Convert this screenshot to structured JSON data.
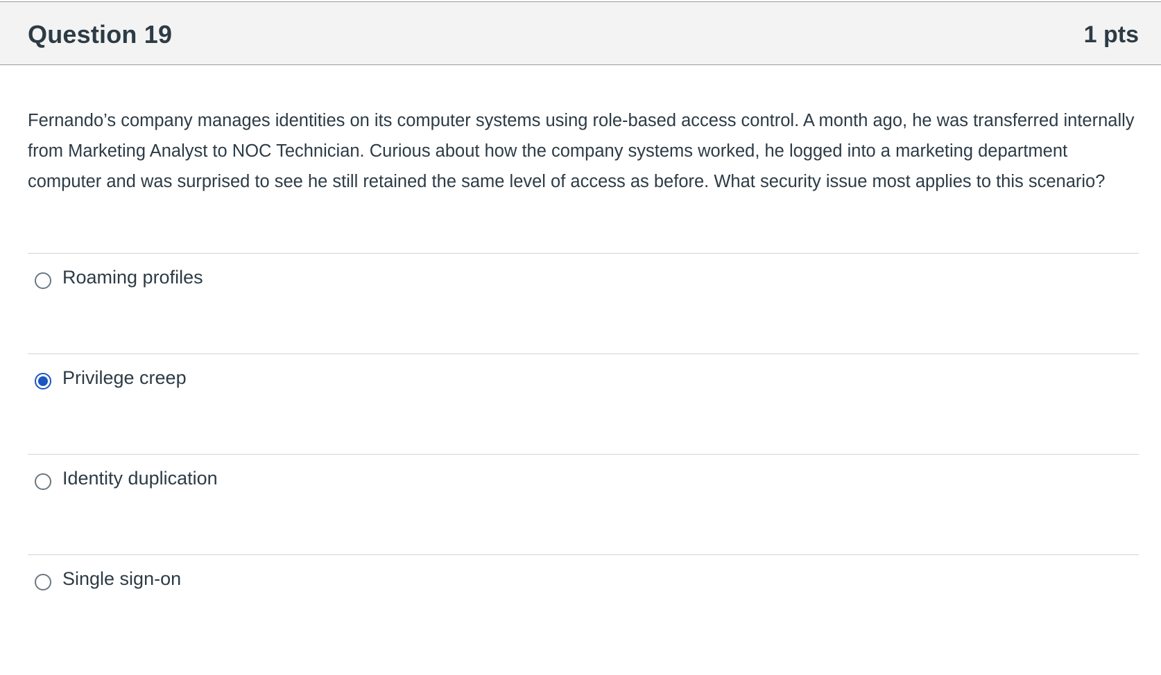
{
  "question": {
    "title": "Question 19",
    "points": "1 pts",
    "text": "Fernando’s company manages identities on its computer systems using role-based access control. A month ago, he was transferred internally from Marketing Analyst to NOC Technician. Curious about how the company systems worked, he logged into a marketing department computer and was surprised to see he still retained the same level of access as before. What security issue most applies to this scenario?"
  },
  "answers": [
    {
      "label": "Roaming profiles",
      "selected": false
    },
    {
      "label": "Privilege creep",
      "selected": true
    },
    {
      "label": "Identity duplication",
      "selected": false
    },
    {
      "label": "Single sign-on",
      "selected": false
    }
  ],
  "colors": {
    "selected_radio": "#1a56c2",
    "header_bg": "#f3f3f3",
    "text": "#2d3b45"
  }
}
